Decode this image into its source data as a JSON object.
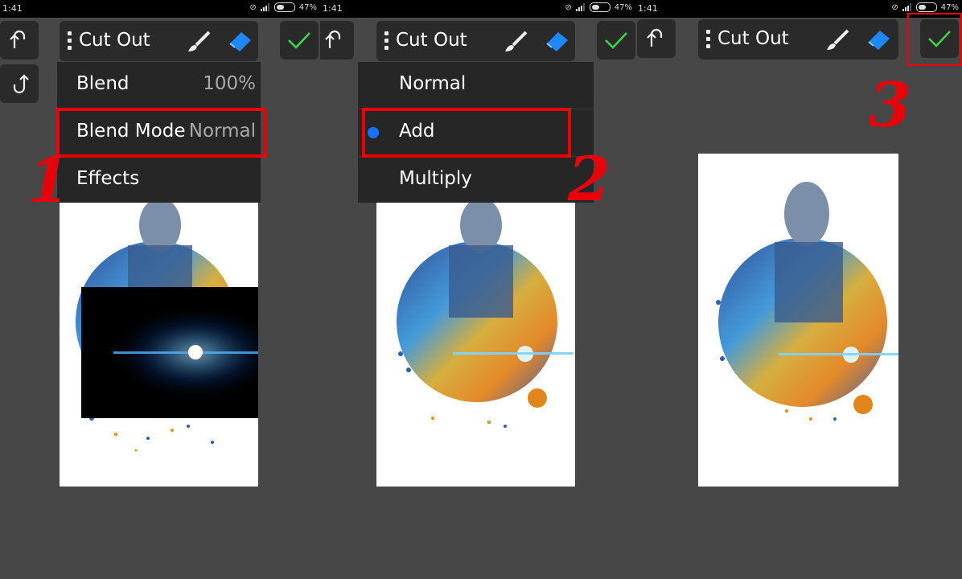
{
  "status": {
    "time": "1:41",
    "battery": "47%"
  },
  "toolbar": {
    "title": "Cut Out"
  },
  "menu1": {
    "blend_label": "Blend",
    "blend_value": "100%",
    "blend_mode_label": "Blend Mode",
    "blend_mode_value": "Normal",
    "effects_label": "Effects"
  },
  "menu2": {
    "options": [
      "Normal",
      "Add",
      "Multiply"
    ],
    "selected": "Add"
  },
  "steps": [
    "1",
    "2",
    "3"
  ],
  "colors": {
    "accent_red": "#e00000",
    "check_green": "#3fd34a",
    "eraser_blue": "#1e88ff",
    "radio_blue": "#1673ff"
  }
}
